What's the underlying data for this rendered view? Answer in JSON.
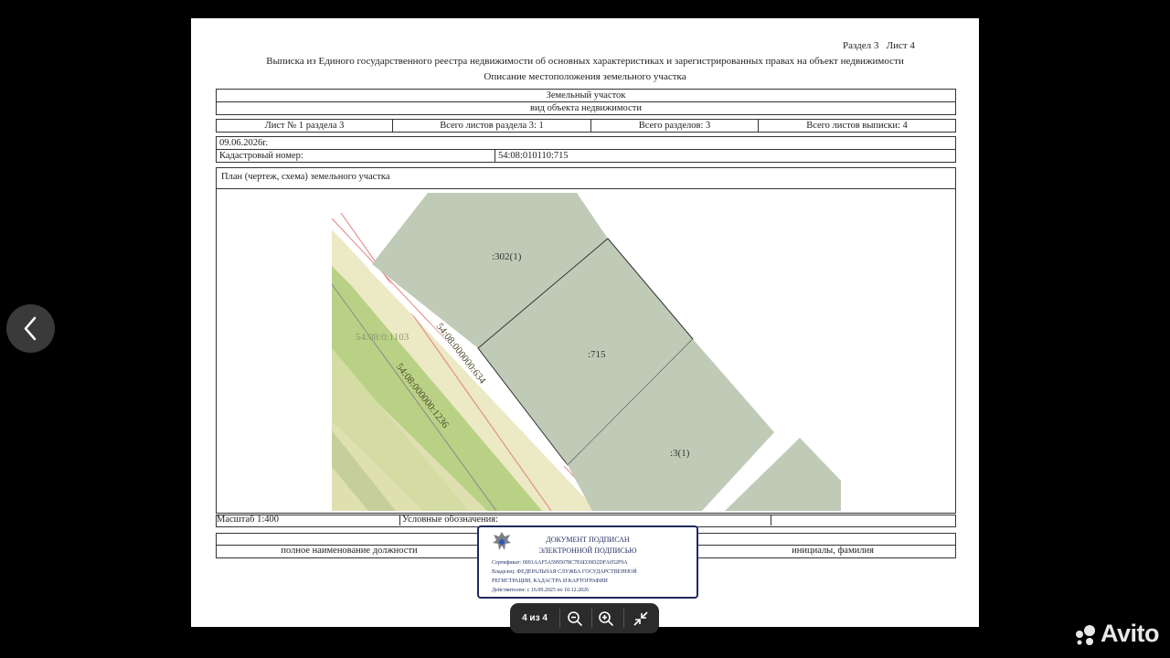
{
  "header": {
    "section_sheet": "Раздел 3   Лист 4",
    "title": "Выписка из Единого государственного реестра недвижимости об основных характеристиках и зарегистрированных правах на объект недвижимости",
    "subtitle": "Описание местоположения земельного участка"
  },
  "object": {
    "type": "Земельный участок",
    "type_caption": "вид объекта недвижимости"
  },
  "sheets": {
    "sheet": "Лист № 1 раздела 3",
    "sheets_in_section": "Всего листов раздела 3: 1",
    "sections_total": "Всего разделов: 3",
    "sheets_total": "Всего листов выписки: 4"
  },
  "date": "09.06.2026г.",
  "cadastral": {
    "label": "Кадастровый номер:",
    "value": "54:08:010110:715"
  },
  "plan": {
    "label": "План (чертеж, схема) земельного участка",
    "parcels": [
      ":302(1)",
      ":715",
      ":3(1)"
    ],
    "labels": [
      "54:08:0:1103",
      "54:08:000000:634",
      "54:08:000000:1236"
    ]
  },
  "footer": {
    "scale": "Масштаб 1:400",
    "legend": "Условные обозначения:",
    "position": "полное наименование должности",
    "initials": "инициалы, фамилия"
  },
  "stamp": {
    "line1": "ДОКУМЕНТ ПОДПИСАН",
    "line2": "ЭЛЕКТРОННОЙ ПОДПИСЬЮ",
    "certificate": "Сертификат: 0091AAF5A5995078C7E6D39D2DFA052F9A",
    "owner1": "Владелец: ФЕДЕРАЛЬНАЯ СЛУЖБА ГОСУДАРСТВЕННОЙ",
    "owner2": "РЕГИСТРАЦИИ, КАДАСТРА И КАРТОГРАФИИ",
    "validity": "Действителен: с 16.09.2025 по 10.12.2026"
  },
  "viewer": {
    "page_indicator": "4 из 4",
    "zoom_out_icon": "zoom-out-icon",
    "zoom_in_icon": "zoom-in-icon",
    "collapse_icon": "collapse-icon",
    "back_icon": "chevron-left-icon"
  },
  "brand": {
    "name": "Avito",
    "color": "#e8e8e8"
  },
  "colors": {
    "parcel_fill": "#c0cbb7",
    "strip_fill": "#ece9c5",
    "green_fill": "#b9d185",
    "stamp_blue": "#1f2a5e"
  }
}
